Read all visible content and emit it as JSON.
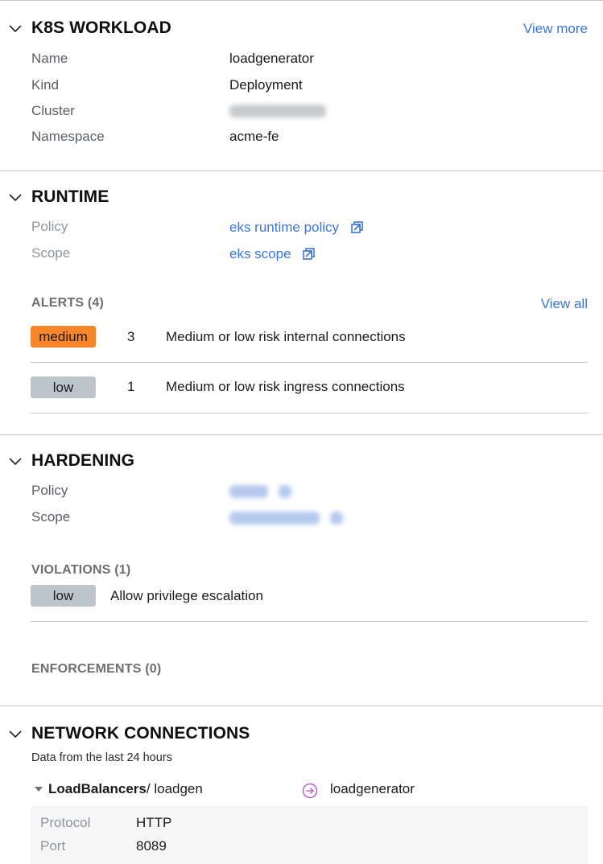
{
  "k8s_workload": {
    "title": "K8S WORKLOAD",
    "view_more": "View more",
    "fields": [
      {
        "label": "Name",
        "value": "loadgenerator"
      },
      {
        "label": "Kind",
        "value": "Deployment"
      },
      {
        "label": "Cluster",
        "value": null,
        "redacted": true
      },
      {
        "label": "Namespace",
        "value": "acme-fe"
      }
    ]
  },
  "runtime": {
    "title": "RUNTIME",
    "policy_label": "Policy",
    "policy_value": "eks runtime policy",
    "scope_label": "Scope",
    "scope_value": "eks scope",
    "alerts_header": "ALERTS (4)",
    "view_all": "View all",
    "alerts": [
      {
        "severity": "medium",
        "count": "3",
        "description": "Medium or low risk internal connections"
      },
      {
        "severity": "low",
        "count": "1",
        "description": "Medium or low risk ingress connections"
      }
    ]
  },
  "hardening": {
    "title": "HARDENING",
    "policy_label": "Policy",
    "policy_value": null,
    "scope_label": "Scope",
    "scope_value": null,
    "violations_header": "VIOLATIONS (1)",
    "violations": [
      {
        "severity": "low",
        "description": "Allow privilege escalation"
      }
    ],
    "enforcements_header": "ENFORCEMENTS (0)"
  },
  "network": {
    "title": "NETWORK CONNECTIONS",
    "subtitle": "Data from the last 24 hours",
    "connection": {
      "source_type": "LoadBalancers",
      "source_name": "/ loadgen",
      "target": "loadgenerator",
      "details": [
        {
          "label": "Protocol",
          "value": "HTTP"
        },
        {
          "label": "Port",
          "value": "8089"
        }
      ]
    }
  },
  "colors": {
    "link": "#3b76d6",
    "severity_medium": "#f7862a",
    "severity_low": "#bcc5cc",
    "ingress_arrow": "#b35ccc"
  },
  "icons": {
    "section_toggle": "chevron-down-icon",
    "external_link": "external-link-icon",
    "expand_caret": "caret-down-icon",
    "connection_direction": "arrow-right-circle-icon"
  }
}
